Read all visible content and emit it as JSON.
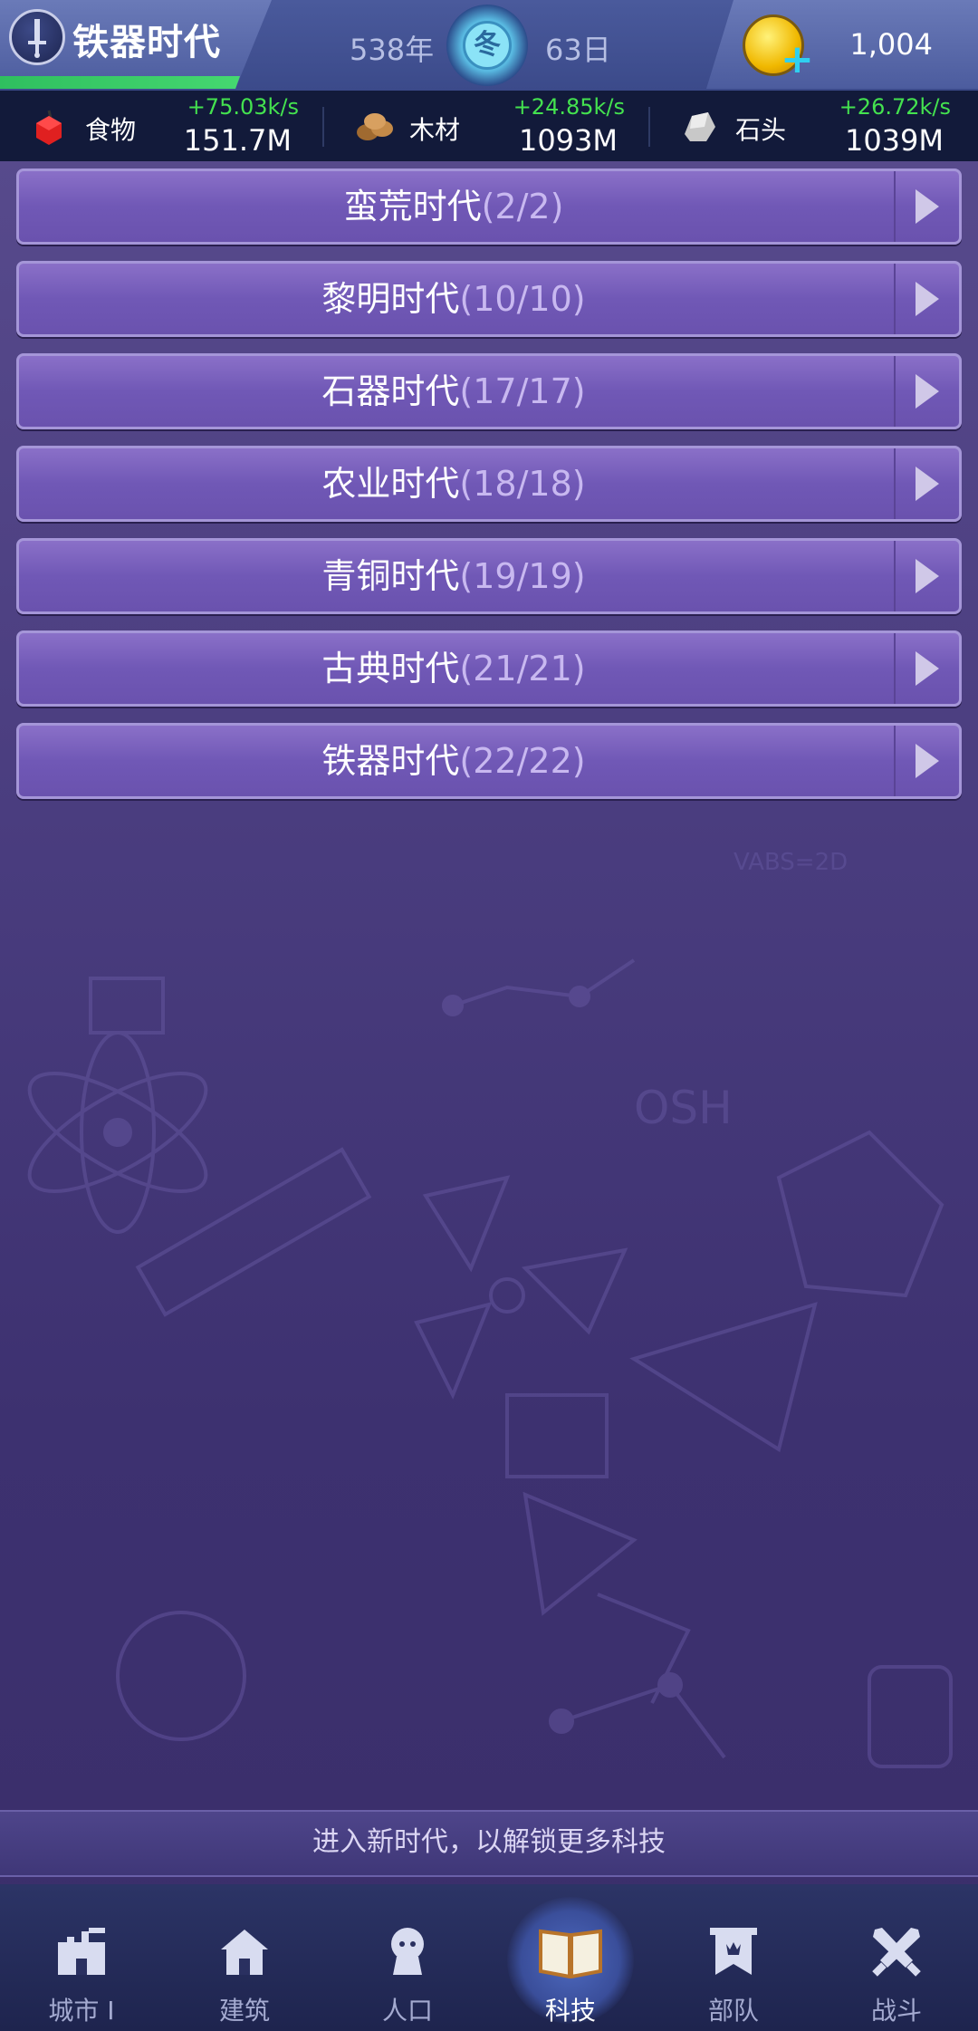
{
  "header": {
    "era_title": "铁器时代",
    "year": "538年",
    "season": "冬",
    "day": "63日",
    "gold": "1,004",
    "progress_fraction": 0.34
  },
  "resources": [
    {
      "name": "食物",
      "rate": "+75.03k/s",
      "value": "151.7M",
      "icon": "apple-icon"
    },
    {
      "name": "木材",
      "rate": "+24.85k/s",
      "value": "1093M",
      "icon": "wood-logs-icon"
    },
    {
      "name": "石头",
      "rate": "+26.72k/s",
      "value": "1039M",
      "icon": "stone-icon"
    }
  ],
  "eras": [
    {
      "name": "蛮荒时代",
      "count": "(2/2)"
    },
    {
      "name": "黎明时代",
      "count": "(10/10)"
    },
    {
      "name": "石器时代",
      "count": "(17/17)"
    },
    {
      "name": "农业时代",
      "count": "(18/18)"
    },
    {
      "name": "青铜时代",
      "count": "(19/19)"
    },
    {
      "name": "古典时代",
      "count": "(21/21)"
    },
    {
      "name": "铁器时代",
      "count": "(22/22)"
    }
  ],
  "hint": "进入新时代，以解锁更多科技",
  "nav": [
    {
      "label": "城市 I",
      "icon": "city-icon"
    },
    {
      "label": "建筑",
      "icon": "house-icon"
    },
    {
      "label": "人口",
      "icon": "person-icon"
    },
    {
      "label": "科技",
      "icon": "book-icon",
      "active": true
    },
    {
      "label": "部队",
      "icon": "banner-icon"
    },
    {
      "label": "战斗",
      "icon": "crossed-swords-icon"
    }
  ],
  "colors": {
    "accent_green": "#44e24f",
    "background": "#4a3d7f",
    "era_row": "#7058b6"
  }
}
